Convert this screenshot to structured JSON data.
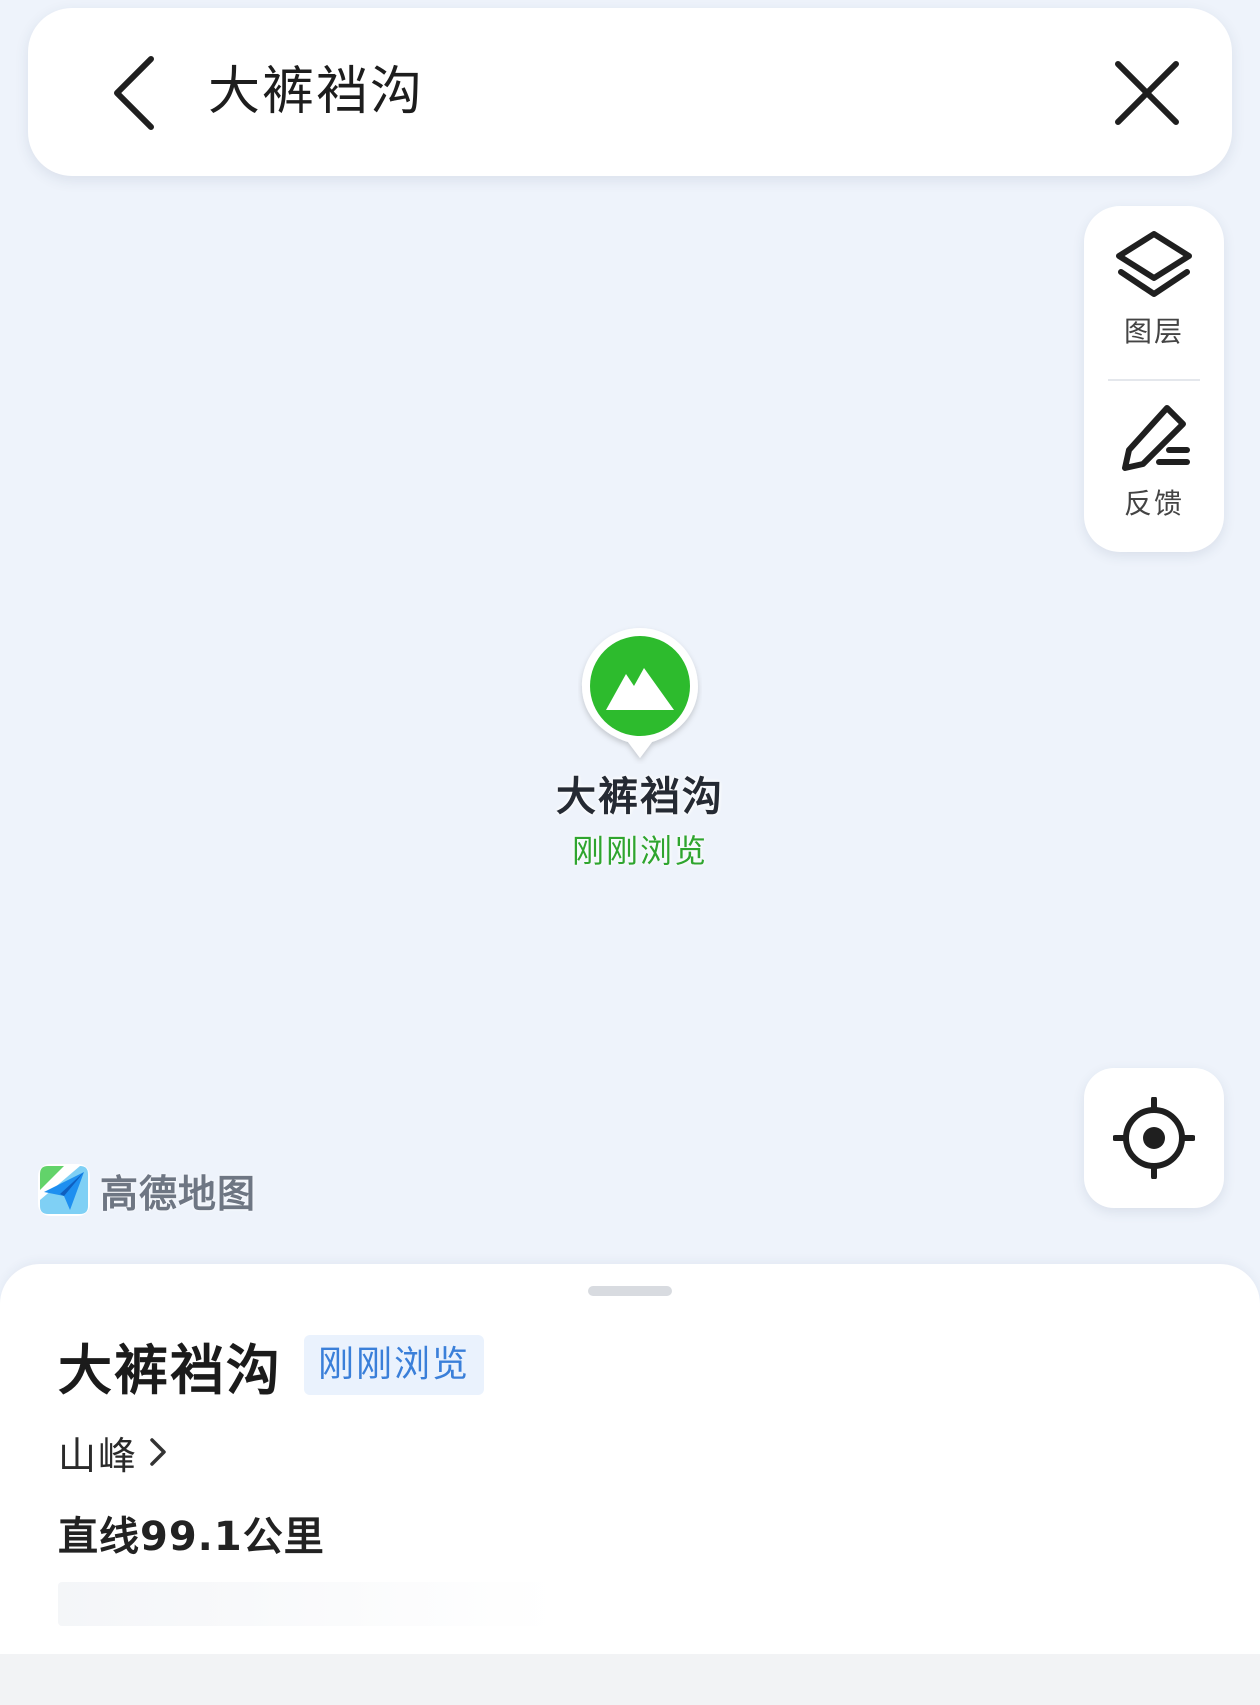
{
  "search": {
    "query": "大裤裆沟"
  },
  "tools": {
    "layers_label": "图层",
    "feedback_label": "反馈"
  },
  "poi": {
    "name": "大裤裆沟",
    "tag": "刚刚浏览",
    "icon": "mountain-icon",
    "color": "#2dbb2d"
  },
  "map": {
    "logo_text": "高德地图"
  },
  "sheet": {
    "title": "大裤裆沟",
    "badge": "刚刚浏览",
    "category": "山峰",
    "distance": "直线99.1公里"
  },
  "colors": {
    "accent_blue": "#3a7fd9",
    "poi_green": "#2dbb2d",
    "map_bg": "#eef3fb"
  }
}
